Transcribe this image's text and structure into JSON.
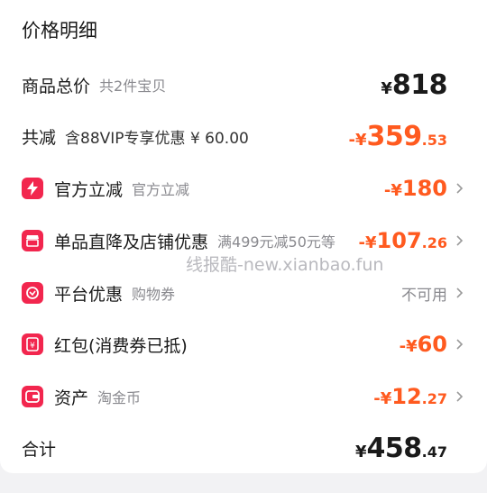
{
  "title": "价格明细",
  "colors": {
    "accent": "#ff5a1f",
    "icon_bg": "#f2264e"
  },
  "rows": {
    "total": {
      "label": "商品总价",
      "sub": "共2件宝贝",
      "yen": "¥",
      "int": "818"
    },
    "reduce": {
      "label": "共减",
      "sub": "含88VIP专享优惠 ¥ 60.00",
      "prefix": "-¥",
      "int": "359",
      "dec": ".53"
    },
    "official": {
      "icon": "lightning-icon",
      "label": "官方立减",
      "sub": "官方立减",
      "prefix": "-¥",
      "int": "180"
    },
    "store": {
      "icon": "shop-icon",
      "label": "单品直降及店铺优惠",
      "sub": "满499元减50元等",
      "prefix": "-¥",
      "int": "107",
      "dec": ".26"
    },
    "platform": {
      "icon": "coupon-icon",
      "label": "平台优惠",
      "sub": "购物券",
      "value": "不可用"
    },
    "redpacket": {
      "icon": "red-packet-icon",
      "label": "红包(消费券已抵)",
      "prefix": "-¥",
      "int": "60"
    },
    "assets": {
      "icon": "wallet-icon",
      "label": "资产",
      "sub": "淘金币",
      "prefix": "-¥",
      "int": "12",
      "dec": ".27"
    },
    "sum": {
      "label": "合计",
      "yen": "¥",
      "int": "458",
      "dec": ".47"
    }
  },
  "watermark": "线报酷-new.xianbao.fun"
}
